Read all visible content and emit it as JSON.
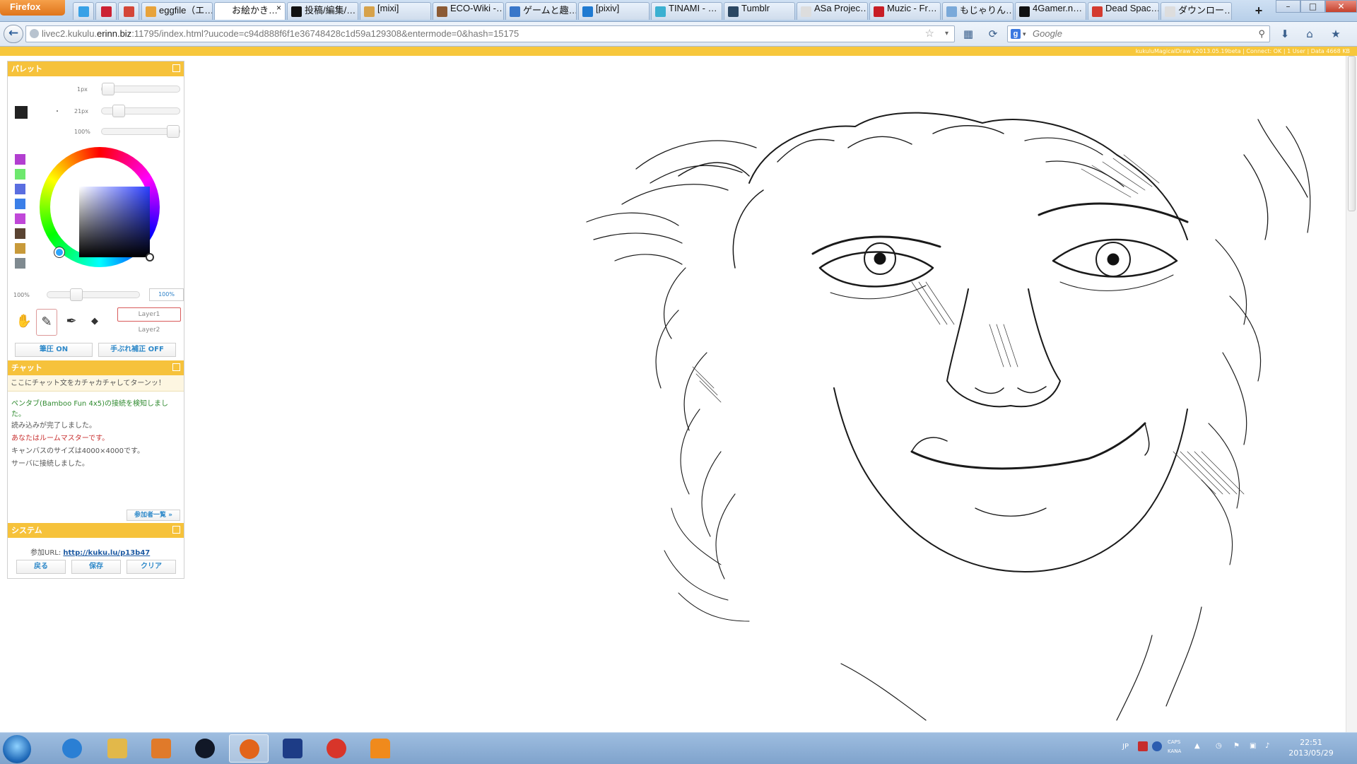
{
  "browser": {
    "menu_label": "Firefox",
    "tabs": [
      {
        "label": "eggfile（エ…",
        "color": "#e8a33a",
        "active": false
      },
      {
        "label": "お絵かき…",
        "color": "#ffffff",
        "active": true
      },
      {
        "label": "投稿/編集/…",
        "color": "#111111",
        "active": false
      },
      {
        "label": "[mixi]",
        "color": "#d7a24a",
        "active": false
      },
      {
        "label": "ECO-Wiki -…",
        "color": "#8c5b35",
        "active": false
      },
      {
        "label": "ゲームと趣…",
        "color": "#3a77c9",
        "active": false
      },
      {
        "label": "[pixiv]",
        "color": "#1f7ad1",
        "active": false
      },
      {
        "label": "TINAMI - …",
        "color": "#3bb0d1",
        "active": false
      },
      {
        "label": "Tumblr",
        "color": "#2c4762",
        "active": false
      },
      {
        "label": "ASa Projec…",
        "color": "#dddddd",
        "active": false
      },
      {
        "label": "Muzic - Fr…",
        "color": "#c81d25",
        "active": false
      },
      {
        "label": "もじゃりん…",
        "color": "#7aa9d9",
        "active": false
      },
      {
        "label": "4Gamer.n…",
        "color": "#111111",
        "active": false
      },
      {
        "label": "Dead Spac…",
        "color": "#d43b2f",
        "active": false
      },
      {
        "label": "ダウンロー…",
        "color": "#dddddd",
        "active": false
      }
    ],
    "pinned_tabs": [
      {
        "name": "twitter-icon",
        "color": "#38a1e6"
      },
      {
        "name": "yahoo-icon",
        "color": "#cc2233"
      },
      {
        "name": "gmail-icon",
        "color": "#d44638"
      }
    ],
    "tab_close": "×",
    "new_tab": "+",
    "window_controls": {
      "minimize": "–",
      "maximize": "□",
      "close": "✕"
    },
    "url": {
      "prefix": "livec2.kukulu.",
      "domain": "erinn.biz",
      "suffix": ":11795/index.html?uucode=c94d888f6f1e36748428c1d59a129308&entermode=0&hash=15175"
    },
    "search_placeholder": "Google",
    "search_engine": "g",
    "icons": {
      "back": "←",
      "star": "☆",
      "reload": "⟳",
      "home": "⌂",
      "download": "⬇",
      "bookmarks": "★",
      "dropdown": "▾",
      "magnifier": "🔍︎"
    }
  },
  "app": {
    "status_line": "kukuluMagicalDraw v2013.05.19beta | Connect: OK | 1 User | Data 4668 KB",
    "palette": {
      "title": "パレット",
      "brush_size_label": "1px",
      "brush_size_2_label": "21px",
      "opacity_label": "100%",
      "dot": "・",
      "current_color": "#222222",
      "swatches": [
        "#b23fd0",
        "#6ee86e",
        "#5a6ee0",
        "#3b7fe8",
        "#c048d8",
        "#5a4432",
        "#c89a3a",
        "#7f8a90"
      ],
      "bottom_opacity_label": "100%",
      "bottom_opacity_value": "100%",
      "tools": {
        "hand": "✋",
        "pen": "✎",
        "dropper": "✒",
        "eraser": "◆"
      },
      "layers": [
        "Layer1",
        "Layer2"
      ],
      "pressure_button": "筆圧 ON",
      "stabilizer_button": "手ぶれ補正 OFF"
    },
    "chat": {
      "title": "チャット",
      "input_placeholder": "ここにチャット文をカチャカチャしてターンッ！",
      "messages": [
        {
          "text": "ペンタブ(Bamboo Fun 4x5)の接続を検知しました。",
          "color": "#2f8a2f"
        },
        {
          "text": "読み込みが完了しました。",
          "color": "#555555"
        },
        {
          "text": "あなたはルームマスターです。",
          "color": "#c83030"
        },
        {
          "text": "キャンバスのサイズは4000×4000です。",
          "color": "#555555"
        },
        {
          "text": "サーバに接続しました。",
          "color": "#555555"
        }
      ],
      "participants_button": "参加者一覧 »"
    },
    "system": {
      "title": "システム",
      "url_label": "参加URL:",
      "url": "http://kuku.lu/p13b47",
      "back_button": "戻る",
      "save_button": "保存",
      "clear_button": "クリア"
    }
  },
  "taskbar": {
    "apps": [
      {
        "name": "ie-icon",
        "color": "#2a7fd4"
      },
      {
        "name": "explorer-icon",
        "color": "#e2b84a"
      },
      {
        "name": "media-player-icon",
        "color": "#e07a2a"
      },
      {
        "name": "camera-icon",
        "color": "#111827"
      },
      {
        "name": "firefox-icon",
        "color": "#e2641a"
      },
      {
        "name": "app-s-icon",
        "color": "#1d3c86"
      },
      {
        "name": "chrome-icon",
        "color": "#d8352a"
      },
      {
        "name": "vlc-icon",
        "color": "#f08a1c"
      }
    ],
    "tray": {
      "lang": "JP",
      "caps": "CAPS",
      "kana": "KANA"
    },
    "clock_time": "22:51",
    "clock_date": "2013/05/29"
  }
}
